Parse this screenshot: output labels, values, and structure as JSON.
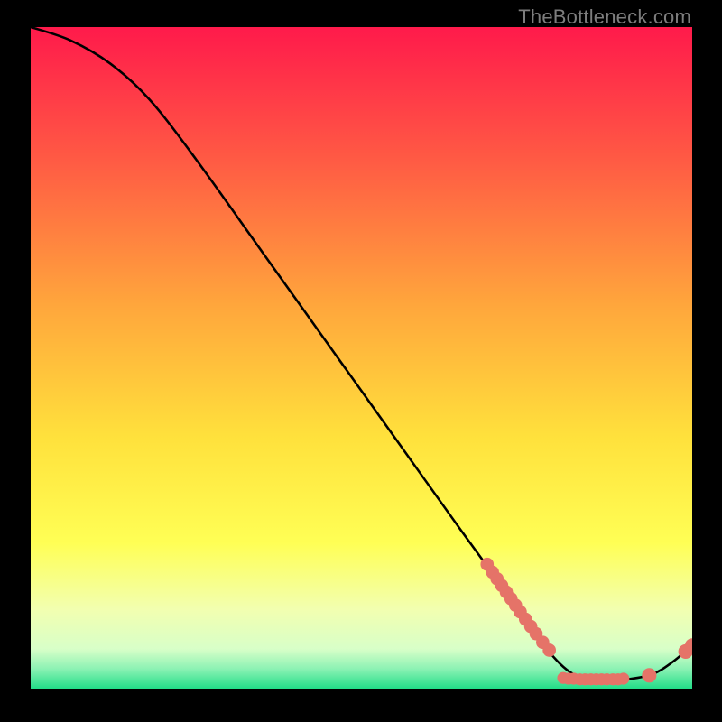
{
  "watermark": "TheBottleneck.com",
  "colors": {
    "page_bg": "#000000",
    "gradient_top": "#ff1a4b",
    "gradient_mid_upper": "#ff7b3a",
    "gradient_mid": "#ffd23a",
    "gradient_mid_lower": "#ffff5a",
    "gradient_pale": "#f5ffbf",
    "gradient_bottom": "#27e08a",
    "curve": "#000000",
    "marker": "#e57368"
  },
  "chart_data": {
    "type": "line",
    "title": "",
    "xlabel": "",
    "ylabel": "",
    "xlim": [
      0,
      100
    ],
    "ylim": [
      0,
      100
    ],
    "grid": false,
    "curve_points": [
      {
        "x": 0,
        "y": 100
      },
      {
        "x": 6,
        "y": 98
      },
      {
        "x": 12,
        "y": 94.5
      },
      {
        "x": 18,
        "y": 89
      },
      {
        "x": 25,
        "y": 80
      },
      {
        "x": 35,
        "y": 66
      },
      {
        "x": 45,
        "y": 52
      },
      {
        "x": 55,
        "y": 38
      },
      {
        "x": 65,
        "y": 24
      },
      {
        "x": 73,
        "y": 13
      },
      {
        "x": 78,
        "y": 6
      },
      {
        "x": 82,
        "y": 2.2
      },
      {
        "x": 86,
        "y": 1.4
      },
      {
        "x": 90,
        "y": 1.4
      },
      {
        "x": 94,
        "y": 2.2
      },
      {
        "x": 97,
        "y": 4.0
      },
      {
        "x": 100,
        "y": 6.5
      }
    ],
    "markers": [
      {
        "x": 69.0,
        "y": 18.8,
        "r": 1.0
      },
      {
        "x": 69.8,
        "y": 17.6,
        "r": 1.0
      },
      {
        "x": 70.5,
        "y": 16.6,
        "r": 1.0
      },
      {
        "x": 71.2,
        "y": 15.6,
        "r": 1.0
      },
      {
        "x": 71.9,
        "y": 14.6,
        "r": 1.0
      },
      {
        "x": 72.6,
        "y": 13.6,
        "r": 1.0
      },
      {
        "x": 73.3,
        "y": 12.6,
        "r": 1.0
      },
      {
        "x": 74.0,
        "y": 11.6,
        "r": 1.0
      },
      {
        "x": 74.8,
        "y": 10.5,
        "r": 1.0
      },
      {
        "x": 75.6,
        "y": 9.4,
        "r": 1.0
      },
      {
        "x": 76.4,
        "y": 8.3,
        "r": 1.0
      },
      {
        "x": 77.4,
        "y": 7.0,
        "r": 1.0
      },
      {
        "x": 78.4,
        "y": 5.8,
        "r": 1.0
      },
      {
        "x": 80.5,
        "y": 1.6,
        "r": 0.9
      },
      {
        "x": 81.3,
        "y": 1.5,
        "r": 0.9
      },
      {
        "x": 82.1,
        "y": 1.5,
        "r": 0.9
      },
      {
        "x": 83.0,
        "y": 1.4,
        "r": 0.9
      },
      {
        "x": 83.8,
        "y": 1.4,
        "r": 0.9
      },
      {
        "x": 84.7,
        "y": 1.4,
        "r": 0.9
      },
      {
        "x": 85.5,
        "y": 1.4,
        "r": 0.9
      },
      {
        "x": 86.3,
        "y": 1.4,
        "r": 0.9
      },
      {
        "x": 87.1,
        "y": 1.4,
        "r": 0.9
      },
      {
        "x": 88.0,
        "y": 1.4,
        "r": 0.9
      },
      {
        "x": 88.8,
        "y": 1.4,
        "r": 0.9
      },
      {
        "x": 89.6,
        "y": 1.5,
        "r": 0.9
      },
      {
        "x": 93.5,
        "y": 2.0,
        "r": 1.1
      },
      {
        "x": 99.0,
        "y": 5.6,
        "r": 1.1
      },
      {
        "x": 100.0,
        "y": 6.5,
        "r": 1.1
      }
    ]
  }
}
